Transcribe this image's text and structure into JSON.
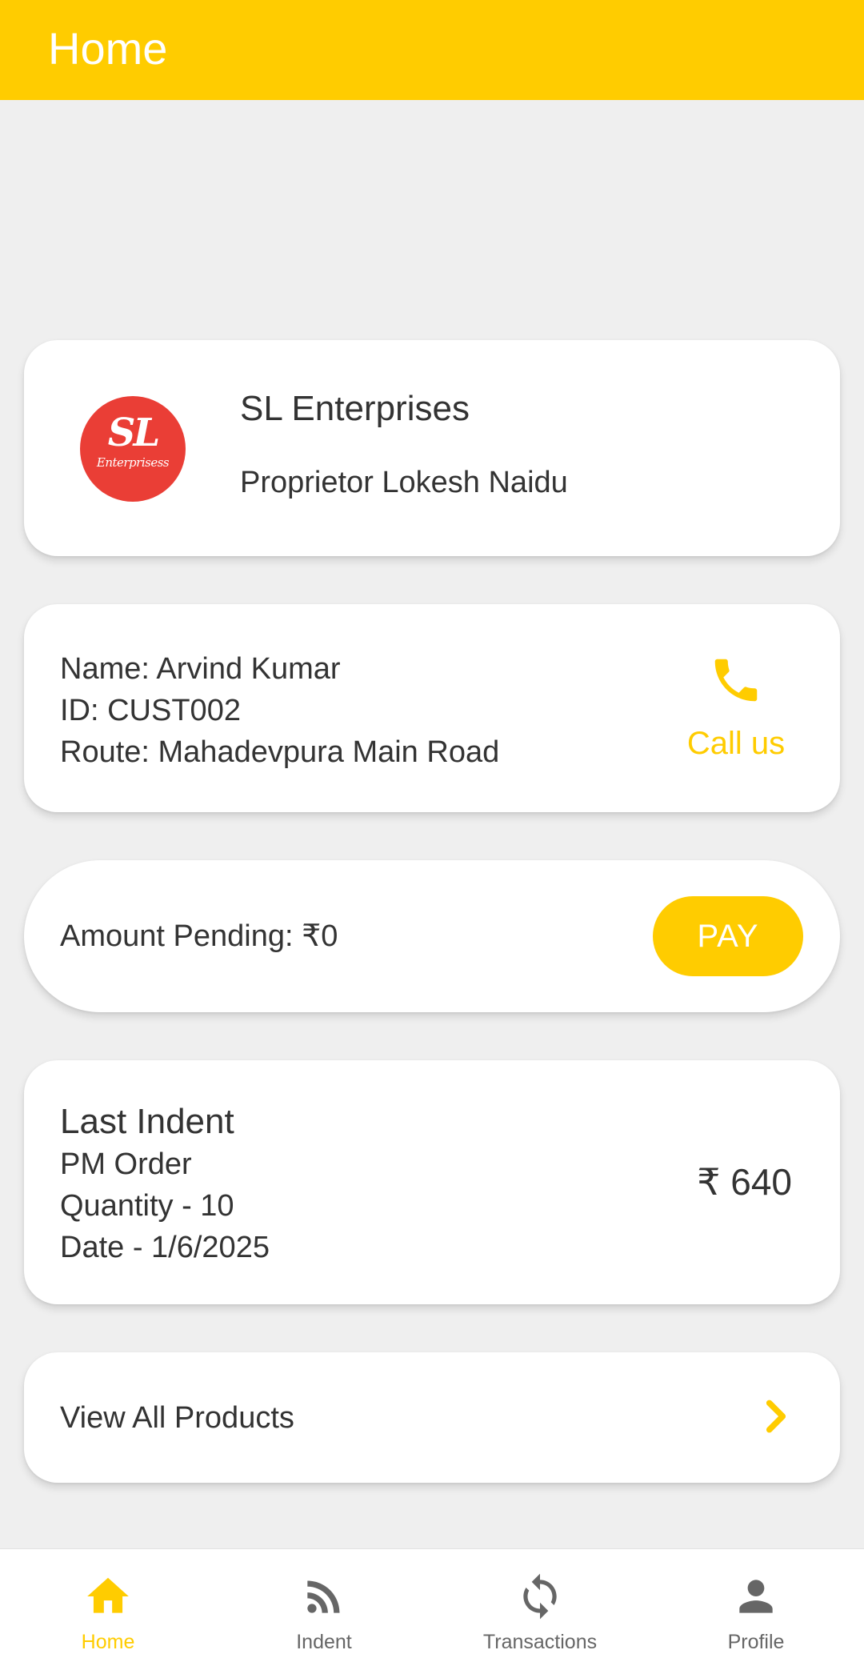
{
  "colors": {
    "accent": "#FFCC00",
    "background": "#EFEFEF",
    "card": "#FFFFFF",
    "logo_red": "#EA3E36",
    "inactive_nav": "#666666"
  },
  "app_bar": {
    "title": "Home"
  },
  "company": {
    "logo_monogram": "SL",
    "logo_wordmark": "Enterprisess",
    "name": "SL Enterprises",
    "owner": "Proprietor Lokesh Naidu"
  },
  "customer": {
    "name_line": "Name: Arvind Kumar",
    "id_line": "ID: CUST002",
    "route_line": "Route: Mahadevpura Main Road",
    "call_icon": "phone-icon",
    "call_label": "Call us"
  },
  "amount": {
    "label": "Amount Pending: ₹0",
    "pay_label": "PAY"
  },
  "last_indent": {
    "title": "Last Indent",
    "order": "PM Order",
    "quantity": "Quantity - 10",
    "date": "Date - 1/6/2025",
    "amount": "₹ 640"
  },
  "products": {
    "label": "View All Products",
    "icon": "chevron-right-icon"
  },
  "bottom_nav": {
    "items": [
      {
        "label": "Home",
        "icon": "home-icon",
        "active": true
      },
      {
        "label": "Indent",
        "icon": "rss-feed-icon",
        "active": false
      },
      {
        "label": "Transactions",
        "icon": "sync-icon",
        "active": false
      },
      {
        "label": "Profile",
        "icon": "person-icon",
        "active": false
      }
    ]
  }
}
